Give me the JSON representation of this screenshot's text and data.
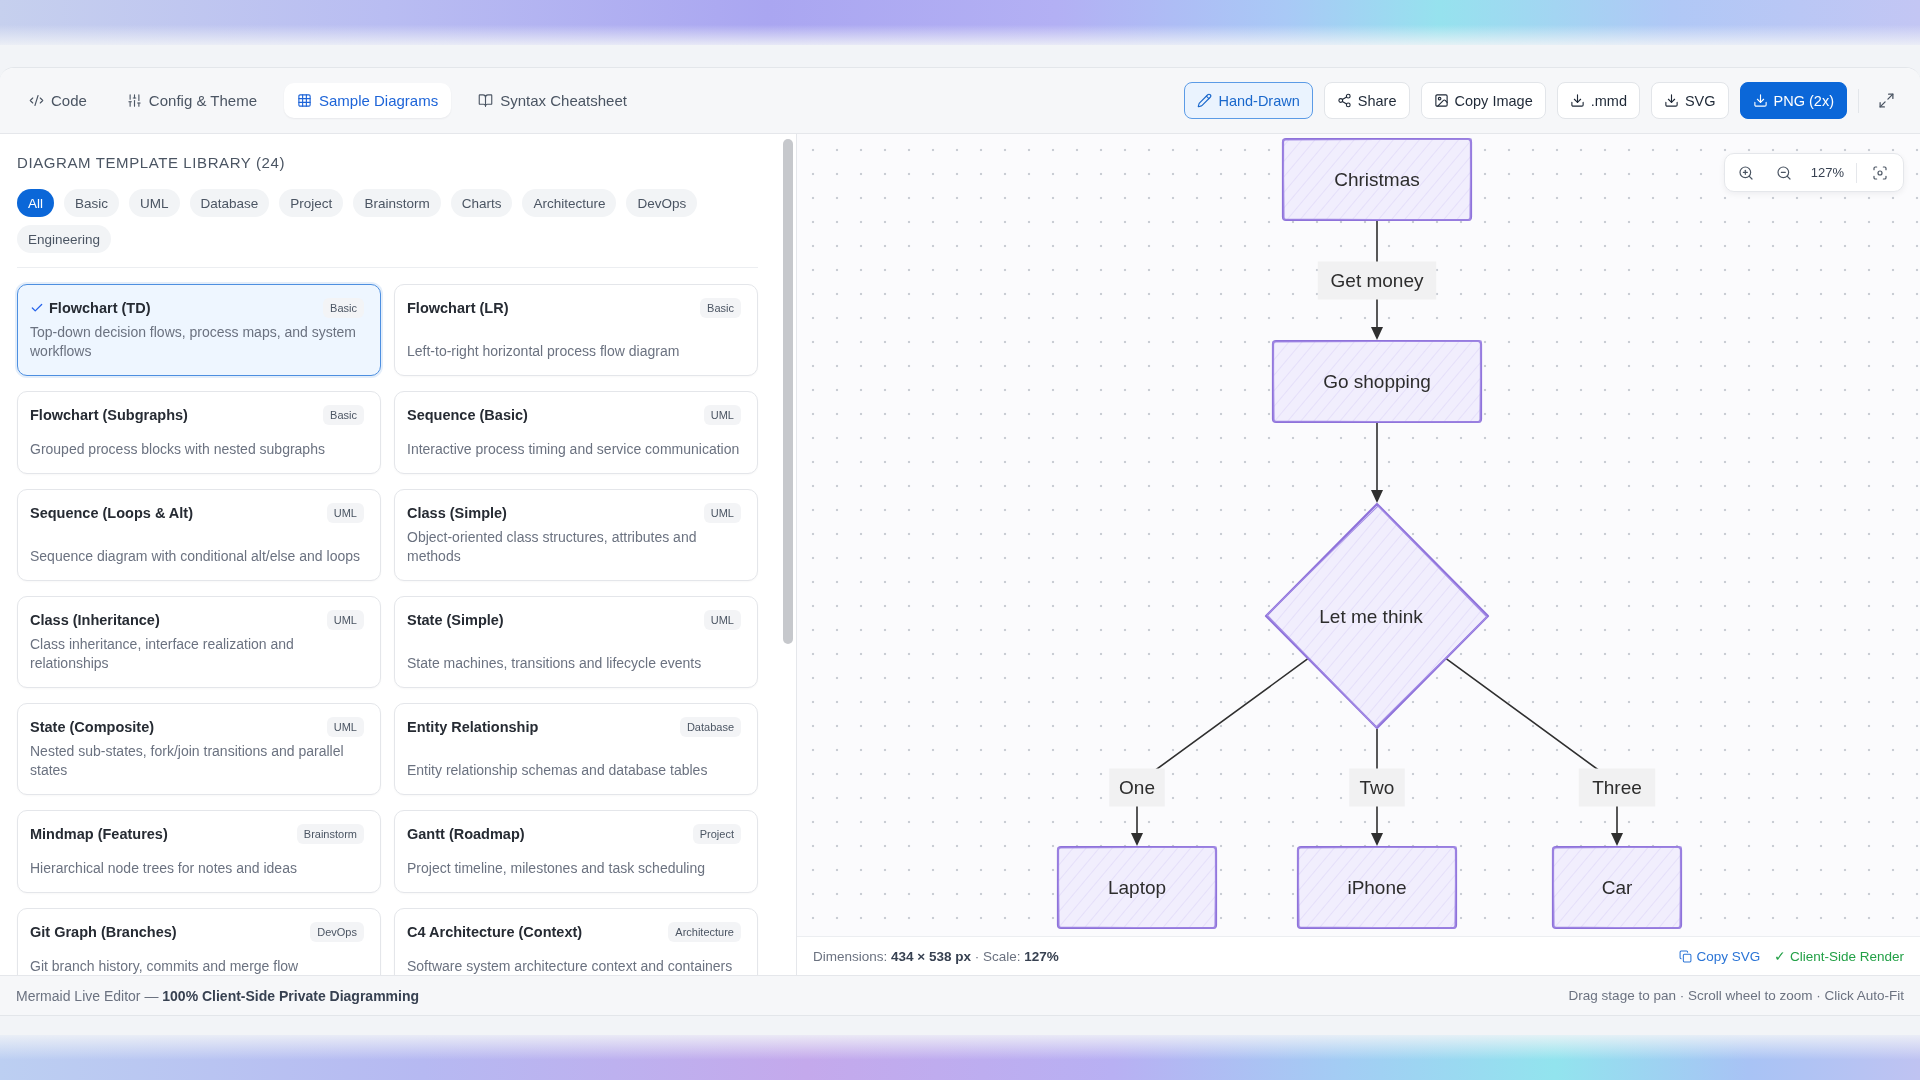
{
  "tabs": [
    {
      "label": "Code",
      "selected": false
    },
    {
      "label": "Config & Theme",
      "selected": false
    },
    {
      "label": "Sample Diagrams",
      "selected": true
    },
    {
      "label": "Syntax Cheatsheet",
      "selected": false
    }
  ],
  "toolbar": {
    "buttons": [
      {
        "label": "Hand-Drawn",
        "kind": "toggle",
        "on": true
      },
      {
        "label": "Share",
        "kind": "plain"
      },
      {
        "label": "Copy Image",
        "kind": "plain"
      },
      {
        "label": ".mmd",
        "kind": "plain"
      },
      {
        "label": "SVG",
        "kind": "plain"
      },
      {
        "label": "PNG (2x)",
        "kind": "primary"
      }
    ]
  },
  "library": {
    "title": "DIAGRAM TEMPLATE LIBRARY (24)",
    "filters": [
      {
        "label": "All",
        "selected": true
      },
      {
        "label": "Basic",
        "selected": false
      },
      {
        "label": "UML",
        "selected": false
      },
      {
        "label": "Database",
        "selected": false
      },
      {
        "label": "Project",
        "selected": false
      },
      {
        "label": "Brainstorm",
        "selected": false
      },
      {
        "label": "Charts",
        "selected": false
      },
      {
        "label": "Architecture",
        "selected": false
      },
      {
        "label": "DevOps",
        "selected": false
      },
      {
        "label": "Engineering",
        "selected": false
      }
    ],
    "templates": [
      {
        "title": "Flowchart (TD)",
        "category": "Basic",
        "description": "Top-down decision flows, process maps, and system workflows",
        "selected": true
      },
      {
        "title": "Flowchart (LR)",
        "category": "Basic",
        "description": "Left-to-right horizontal process flow diagram",
        "selected": false
      },
      {
        "title": "Flowchart (Subgraphs)",
        "category": "Basic",
        "description": "Grouped process blocks with nested subgraphs",
        "selected": false
      },
      {
        "title": "Sequence (Basic)",
        "category": "UML",
        "description": "Interactive process timing and service communication",
        "selected": false
      },
      {
        "title": "Sequence (Loops & Alt)",
        "category": "UML",
        "description": "Sequence diagram with conditional alt/else and loops",
        "selected": false
      },
      {
        "title": "Class (Simple)",
        "category": "UML",
        "description": "Object-oriented class structures, attributes and methods",
        "selected": false
      },
      {
        "title": "Class (Inheritance)",
        "category": "UML",
        "description": "Class inheritance, interface realization and relationships",
        "selected": false
      },
      {
        "title": "State (Simple)",
        "category": "UML",
        "description": "State machines, transitions and lifecycle events",
        "selected": false
      },
      {
        "title": "State (Composite)",
        "category": "UML",
        "description": "Nested sub-states, fork/join transitions and parallel states",
        "selected": false
      },
      {
        "title": "Entity Relationship",
        "category": "Database",
        "description": "Entity relationship schemas and database tables",
        "selected": false
      },
      {
        "title": "Mindmap (Features)",
        "category": "Brainstorm",
        "description": "Hierarchical node trees for notes and ideas",
        "selected": false
      },
      {
        "title": "Gantt (Roadmap)",
        "category": "Project",
        "description": "Project timeline, milestones and task scheduling",
        "selected": false
      },
      {
        "title": "Git Graph (Branches)",
        "category": "DevOps",
        "description": "Git branch history, commits and merge flow",
        "selected": false
      },
      {
        "title": "C4 Architecture (Context)",
        "category": "Architecture",
        "description": "Software system architecture context and containers",
        "selected": false
      }
    ]
  },
  "canvas": {
    "zoom": {
      "reading": "127%"
    },
    "flowchart": {
      "label": "Christmas",
      "kind": "process",
      "children": [
        {
          "edge_label": "Get money",
          "label": "Go shopping",
          "kind": "process",
          "children": [
            {
              "label": "Let me think",
              "kind": "decision",
              "children": [
                {
                  "edge_label": "One",
                  "label": "Laptop",
                  "kind": "process"
                },
                {
                  "edge_label": "Two",
                  "label": "iPhone",
                  "kind": "process"
                },
                {
                  "edge_label": "Three",
                  "label": "Car",
                  "kind": "process"
                }
              ]
            }
          ]
        }
      ]
    },
    "info": "Dimensions: **434 × 538 px** · Scale: **127%**",
    "copy_link": "Copy SVG",
    "render_status": "✓ Client-Side Render"
  },
  "footer": {
    "left": "Mermaid Live Editor — **100% Client-Side Private Diagramming**",
    "right": "Drag stage to pan · Scroll wheel to zoom · Click Auto-Fit"
  }
}
